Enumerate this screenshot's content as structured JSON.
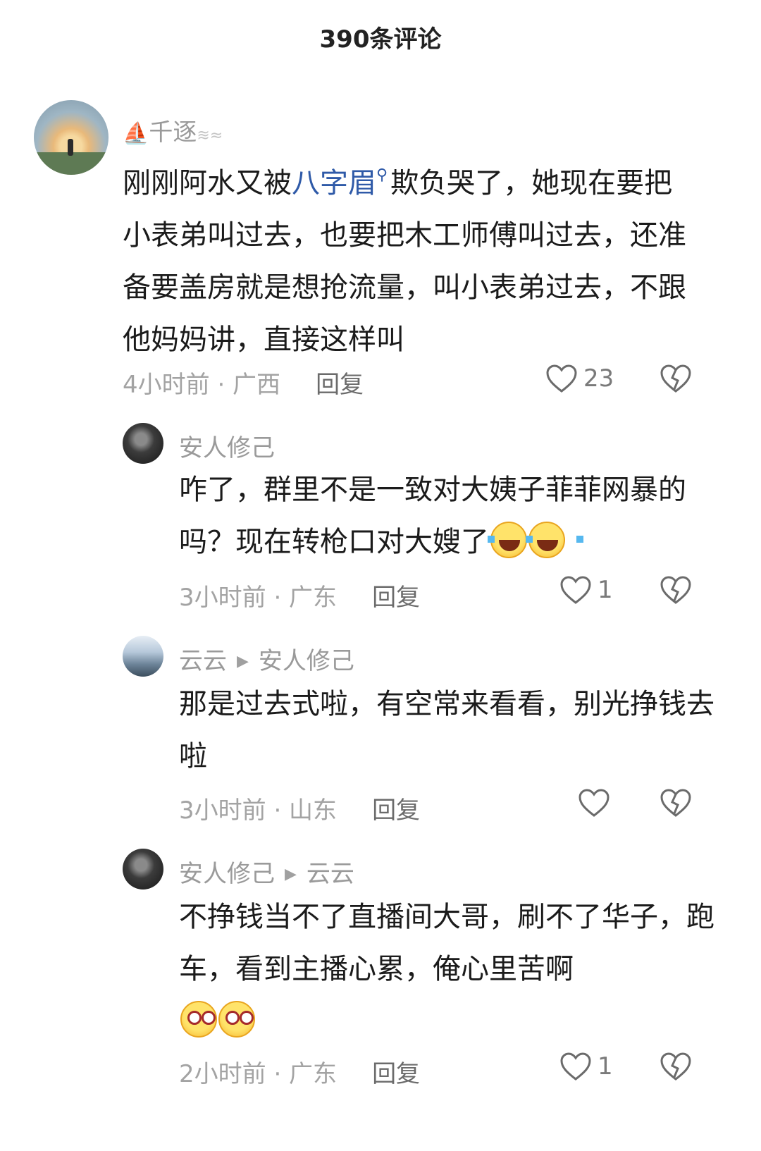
{
  "header": {
    "title": "390条评论"
  },
  "comments": [
    {
      "username": "千逐",
      "text_before": "刚刚阿水又被",
      "link": "八字眉",
      "text_after": "欺负哭了，她现在要把小表弟叫过去，也要把木工师傅叫过去，还准备要盖房就是想抢流量，叫小表弟过去，不跟他妈妈讲，直接这样叫",
      "time_location": "4小时前 · 广西",
      "reply_label": "回复",
      "likes": "23"
    },
    {
      "username": "安人修己",
      "text": "咋了，群里不是一致对大姨子菲菲网暴的吗？现在转枪口对大嫂了",
      "emojis": [
        "laugh-cry-emoji",
        "laugh-cry-emoji"
      ],
      "time_location": "3小时前 · 广东",
      "reply_label": "回复",
      "likes": "1"
    },
    {
      "username": "云云",
      "reply_to": "安人修己",
      "text": "那是过去式啦，有空常来看看，别光挣钱去啦",
      "time_location": "3小时前 · 山东",
      "reply_label": "回复",
      "likes": ""
    },
    {
      "username": "安人修己",
      "reply_to": "云云",
      "text": "不挣钱当不了直播间大哥，刷不了华子，跑车，看到主播心累，俺心里苦啊",
      "emojis": [
        "wide-eyes-emoji",
        "wide-eyes-emoji"
      ],
      "time_location": "2小时前 · 广东",
      "reply_label": "回复",
      "likes": "1"
    }
  ],
  "colors": {
    "link": "#2f5aa8",
    "meta": "#a3a3a3",
    "reply": "#6b6b6b"
  }
}
